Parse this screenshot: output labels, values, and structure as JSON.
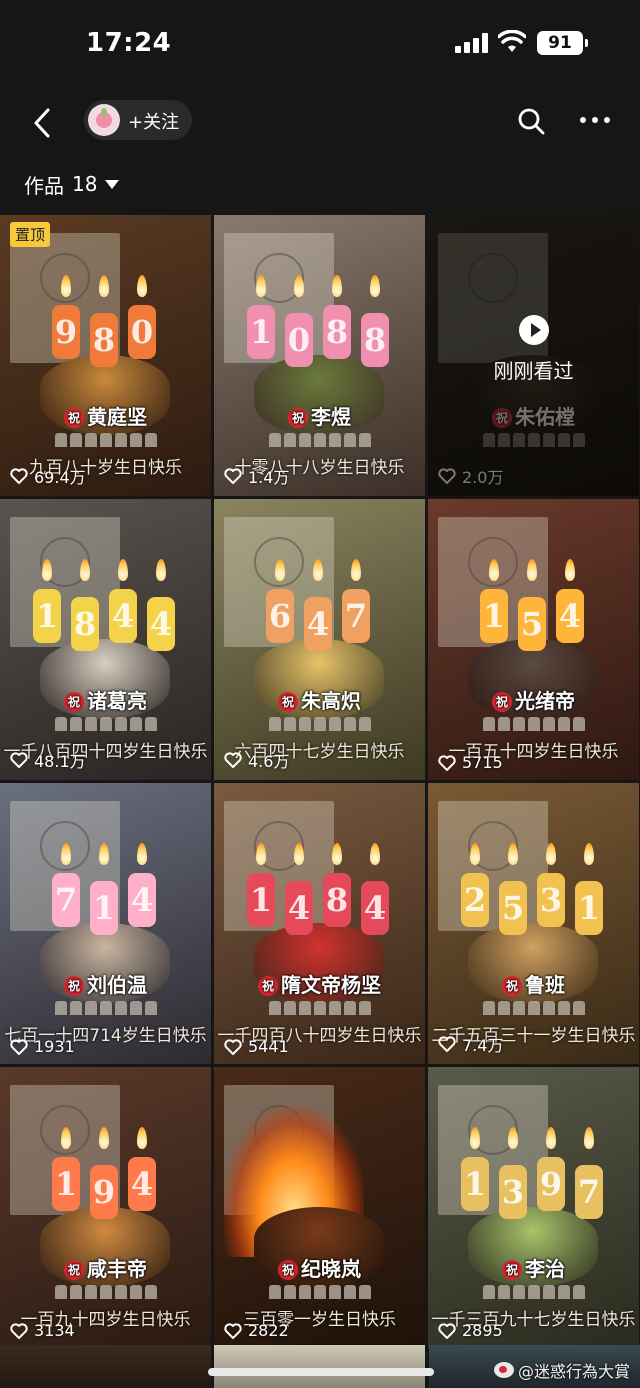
{
  "status_bar": {
    "time": "17:24",
    "battery": "91"
  },
  "nav": {
    "follow_label": "+关注"
  },
  "works": {
    "label": "作品",
    "count": "18"
  },
  "tiles": [
    {
      "name": "黄庭坚",
      "greeting": "九百八十岁生日快乐",
      "likes": "69.4万",
      "candles": [
        "9",
        "8",
        "0"
      ],
      "pinned_label": "置顶",
      "theme": "warm"
    },
    {
      "name": "李煜",
      "greeting": "十零八十八岁生日快乐",
      "likes": "1.4万",
      "candles": [
        "1",
        "0",
        "8",
        "8"
      ],
      "theme": "pink"
    },
    {
      "name": "朱佑樘",
      "greeting": "",
      "likes": "2.0万",
      "candles": [],
      "watched_label": "刚刚看过",
      "theme": "dark"
    },
    {
      "name": "诸葛亮",
      "greeting": "一千八百四十四岁生日快乐",
      "likes": "48.1万",
      "candles": [
        "1",
        "8",
        "4",
        "4"
      ],
      "theme": "gold"
    },
    {
      "name": "朱高炽",
      "greeting": "六百四十七岁生日快乐",
      "likes": "4.6万",
      "candles": [
        "6",
        "4",
        "7"
      ],
      "theme": "cream"
    },
    {
      "name": "光绪帝",
      "greeting": "一百五十四岁生日快乐",
      "likes": "5715",
      "candles": [
        "1",
        "5",
        "4"
      ],
      "theme": "red"
    },
    {
      "name": "刘伯温",
      "greeting": "七百一十四714岁生日快乐",
      "likes": "1931",
      "candles": [
        "7",
        "1",
        "4"
      ],
      "theme": "blue"
    },
    {
      "name": "隋文帝杨坚",
      "greeting": "一千四百八十四岁生日快乐",
      "likes": "5441",
      "candles": [
        "1",
        "4",
        "8",
        "4"
      ],
      "theme": "berry"
    },
    {
      "name": "鲁班",
      "greeting": "二千五百三十一岁生日快乐",
      "likes": "7.4万",
      "candles": [
        "2",
        "5",
        "3",
        "1"
      ],
      "theme": "amber"
    },
    {
      "name": "咸丰帝",
      "greeting": "一百九十四岁生日快乐",
      "likes": "3134",
      "candles": [
        "1",
        "9",
        "4"
      ],
      "theme": "orange"
    },
    {
      "name": "纪晓岚",
      "greeting": "三百零一岁生日快乐",
      "likes": "2822",
      "candles": [],
      "theme": "fire"
    },
    {
      "name": "李治",
      "greeting": "一千三百九十七岁生日快乐",
      "likes": "2895",
      "candles": [
        "1",
        "3",
        "9",
        "7"
      ],
      "theme": "green"
    }
  ],
  "tile_badge": "祝",
  "watermark": "@迷惑行為大賞",
  "colors": {
    "background": "#161616",
    "pin": "#f6c83a",
    "badge": "#d6262f"
  }
}
